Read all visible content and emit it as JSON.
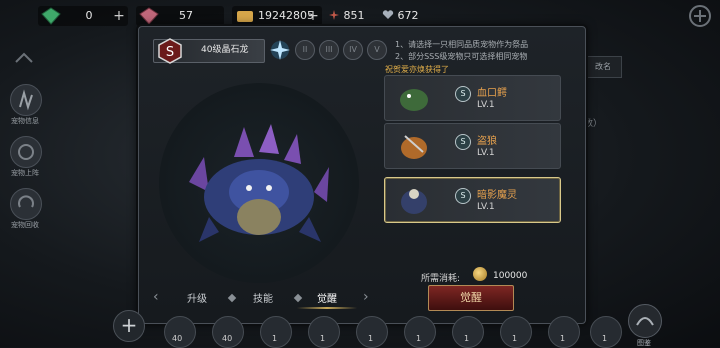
{
  "resources": {
    "gems": "0",
    "crystals": "57",
    "gold": "19242805",
    "stamina": "851",
    "hearts": "672"
  },
  "sidebar": {
    "items": [
      {
        "label": "宠物信息"
      },
      {
        "label": "宠物上阵"
      },
      {
        "label": "宠物回收"
      }
    ]
  },
  "panel": {
    "grade": "S",
    "pet_name": "40级晶石龙",
    "roman_levels": [
      "II",
      "III",
      "IV",
      "V"
    ],
    "tips": [
      "1、请选择一只相同品质宠物作为祭品",
      "2、部分SSS级宠物只可选择相同宠物"
    ],
    "bless_text": "祝贺爱亦焕获得了",
    "candidates": [
      {
        "grade": "S",
        "name": "血口鳄",
        "level": "LV.1",
        "selected": false
      },
      {
        "grade": "S",
        "name": "盗狼",
        "level": "LV.1",
        "selected": false
      },
      {
        "grade": "S",
        "name": "暗影魔灵",
        "level": "LV.1",
        "selected": true
      }
    ],
    "cost_label": "所需消耗:",
    "cost_value": "100000",
    "tabs": [
      "升级",
      "技能",
      "觉醒"
    ],
    "active_tab": "觉醒",
    "awaken_button": "觉醒"
  },
  "bottom": {
    "slot_levels": [
      "40",
      "40",
      "1",
      "1",
      "1",
      "1",
      "1",
      "1",
      "1",
      "1"
    ],
    "codex_label": "图鉴"
  },
  "right": {
    "rename": "改名",
    "fragment": "数）"
  },
  "colors": {
    "accent_gold": "#e3b04a",
    "name_orange": "#e8a24e",
    "button_red": "#7e2723",
    "selected_border": "#d9c98a"
  }
}
